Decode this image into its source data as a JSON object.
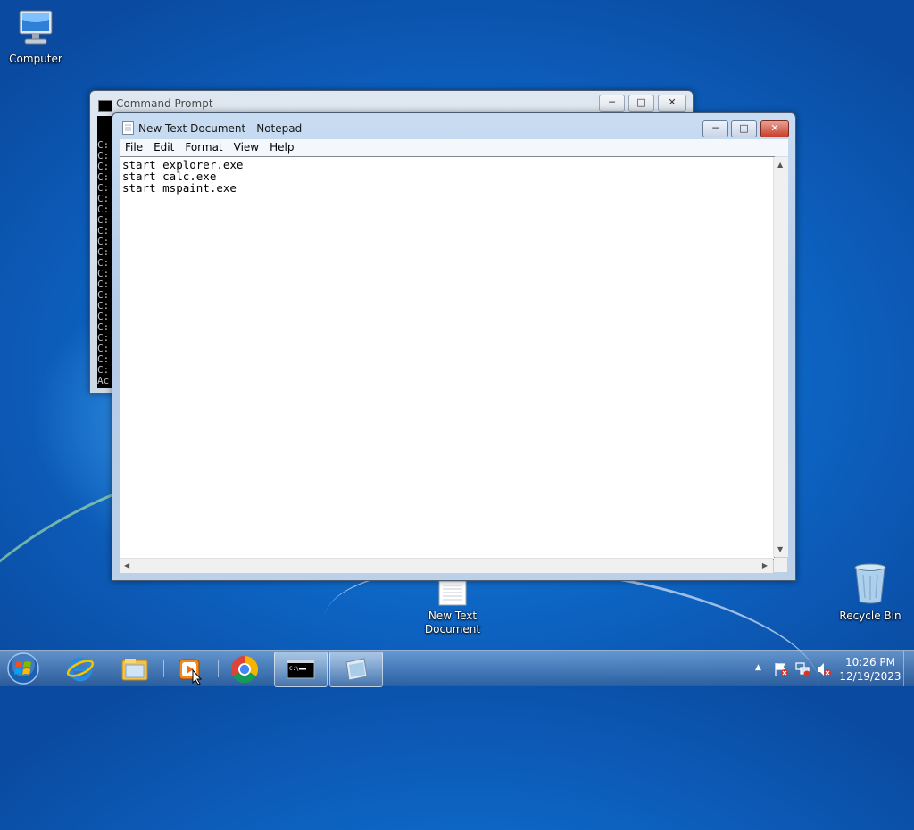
{
  "desktop": {
    "icons": [
      {
        "label": "Computer"
      },
      {
        "label": "New Text Document"
      },
      {
        "label": "Recycle Bin"
      }
    ]
  },
  "cmd": {
    "title": "Command Prompt",
    "lines": [
      "C:",
      "C:",
      "C:",
      "C:",
      "C:",
      "C:",
      "C:",
      "C:",
      "C:",
      "C:",
      "C:",
      "C:",
      "C:",
      "C:",
      "C:",
      "C:",
      "C:",
      "C:",
      "C:",
      "C:",
      "C:",
      "C:",
      "Ac",
      "",
      "C:"
    ]
  },
  "notepad": {
    "title": "New Text Document - Notepad",
    "menu": [
      "File",
      "Edit",
      "Format",
      "View",
      "Help"
    ],
    "content": "start explorer.exe\nstart calc.exe\nstart mspaint.exe"
  },
  "window_controls": {
    "minimize": "─",
    "maximize": "□",
    "close": "✕"
  },
  "taskbar": {
    "pinned": [
      "start-orb-icon",
      "internet-explorer-icon",
      "windows-explorer-icon",
      "media-player-icon",
      "chrome-icon",
      "command-prompt-icon",
      "notepad-icon"
    ],
    "tray": {
      "time": "10:26 PM",
      "date": "12/19/2023",
      "expand": "▲"
    }
  },
  "colors": {
    "accent": "#0d63c2",
    "close_red": "#c7402b"
  }
}
